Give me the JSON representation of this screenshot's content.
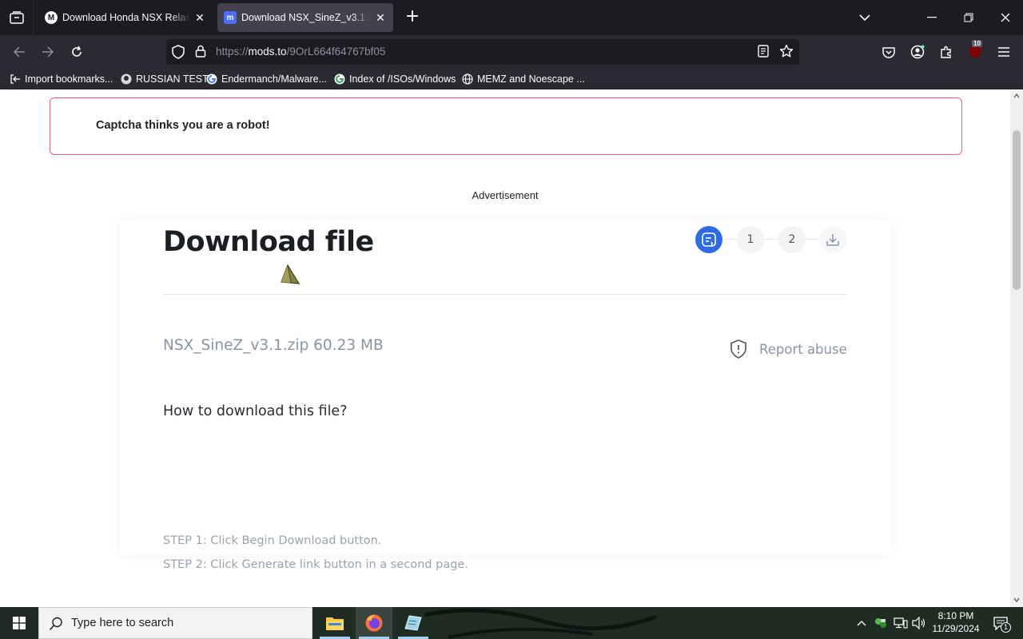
{
  "browser": {
    "tabs": [
      {
        "title": "Download Honda NSX Relase - ",
        "active": false
      },
      {
        "title": "Download NSX_SineZ_v3.1.zip - ",
        "active": true
      }
    ],
    "url_prefix": "https://",
    "url_domain": "mods.to",
    "url_path": "/9OrL664f64767bf05",
    "extension_badge": "10",
    "bookmarks": [
      {
        "label": "Import bookmarks...",
        "icon": "import-icon"
      },
      {
        "label": "RUSSIAN TEST",
        "icon": "github-icon"
      },
      {
        "label": "Endermanch/Malware...",
        "icon": "google-icon"
      },
      {
        "label": "Index of /ISOs/Windows",
        "icon": "google-icon"
      },
      {
        "label": "MEMZ and Noescape ...",
        "icon": "globe-icon"
      }
    ]
  },
  "page": {
    "alert_text": "Captcha thinks you are a robot!",
    "ad_label": "Advertisement",
    "title": "Download file",
    "steps": [
      "1",
      "2"
    ],
    "file_name": "NSX_SineZ_v3.1.zip",
    "file_size": "60.23 MB",
    "report_label": "Report abuse",
    "how_title": "How to download this file?",
    "step1_text": "STEP 1: Click Begin Download button.",
    "step2_text": "STEP 2: Click Generate link button in a second page."
  },
  "taskbar": {
    "search_placeholder": "Type here to search",
    "time": "8:10 PM",
    "date": "11/29/2024",
    "notification_count": "1"
  },
  "colors": {
    "accent": "#2d6be4",
    "alert_border": "#e4657b",
    "chrome_dark": "#1c1b22",
    "chrome_mid": "#2b2a33"
  }
}
